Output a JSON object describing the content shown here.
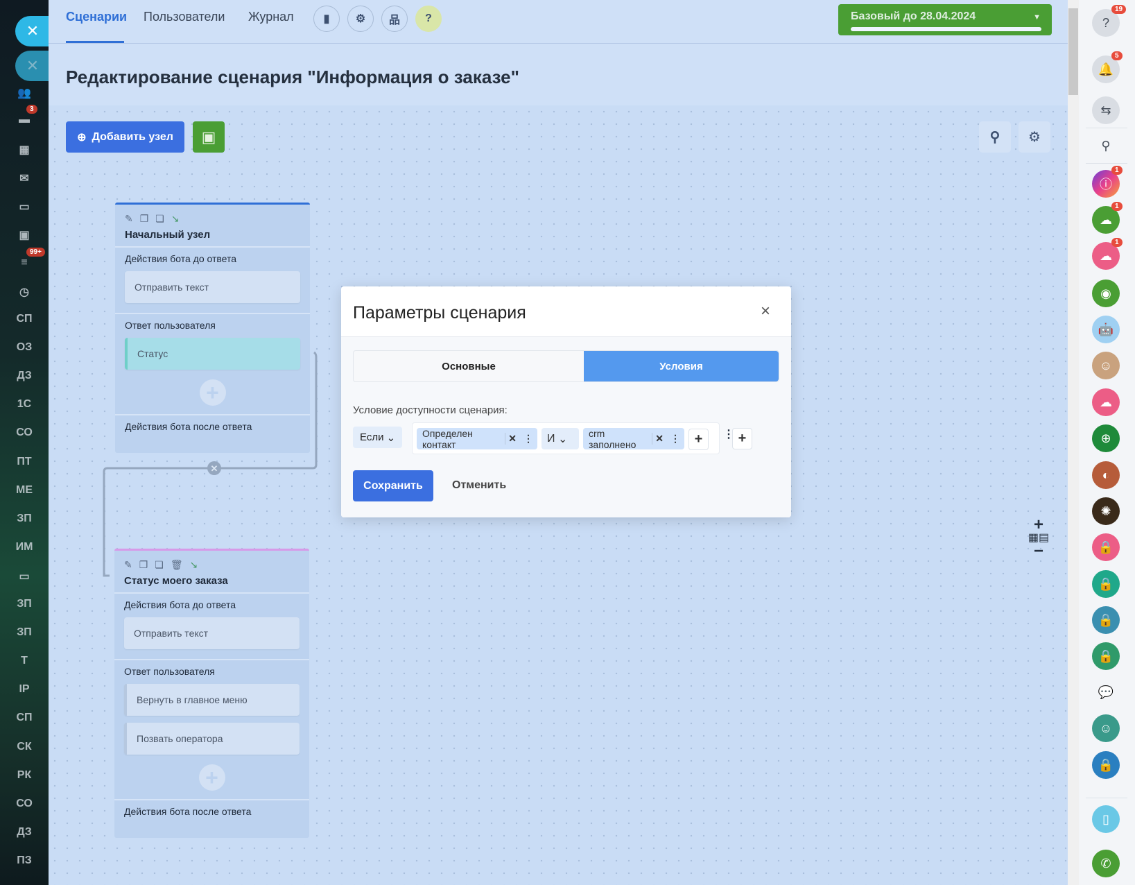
{
  "nav": {
    "tabs": [
      "Сценарии",
      "Пользователи",
      "Журнал"
    ],
    "active": 0,
    "help": "?"
  },
  "plan": {
    "label": "Базовый до 28.04.2024",
    "progress": 1.0
  },
  "page_title": "Редактирование сценария \"Информация о заказе\"",
  "toolbar": {
    "add_node": "Добавить узел"
  },
  "left_sidebar": {
    "badges": {
      "chat": "3",
      "filter": "99+"
    },
    "text_items": [
      "СП",
      "ОЗ",
      "ДЗ",
      "1С",
      "СО",
      "ПТ",
      "МЕ",
      "ЗП",
      "ИМ",
      "",
      "ЗП",
      "ЗП",
      "Т",
      "IP",
      "СП",
      "СК",
      "РК",
      "СО",
      "ДЗ",
      "ПЗ"
    ]
  },
  "nodes": [
    {
      "title": "Начальный узел",
      "before": "Действия бота до ответа",
      "before_items": [
        "Отправить текст"
      ],
      "answer": "Ответ пользователя",
      "answer_items": [
        "Статус"
      ],
      "after": "Действия бота после ответа"
    },
    {
      "title": "Статус моего заказа",
      "before": "Действия бота до ответа",
      "before_items": [
        "Отправить текст"
      ],
      "answer": "Ответ пользователя",
      "answer_items": [
        "Вернуть в главное меню",
        "Позвать оператора"
      ],
      "after": "Действия бота после ответа"
    }
  ],
  "modal": {
    "title": "Параметры сценария",
    "tabs": [
      "Основные",
      "Условия"
    ],
    "active_tab": 1,
    "condition_label": "Условие доступности сценария:",
    "if_label": "Если",
    "cond1": "Определен контакт",
    "op": "И",
    "cond2": "crm заполнено",
    "save": "Сохранить",
    "cancel": "Отменить"
  },
  "right_sidebar": {
    "badges": {
      "help": "19",
      "notifications": "5",
      "app1": "1",
      "app2": "1",
      "app3": "1"
    }
  },
  "colors": {
    "accent": "#3b6fe0",
    "green": "#4a9e34",
    "tab_active": "#5499ee"
  }
}
